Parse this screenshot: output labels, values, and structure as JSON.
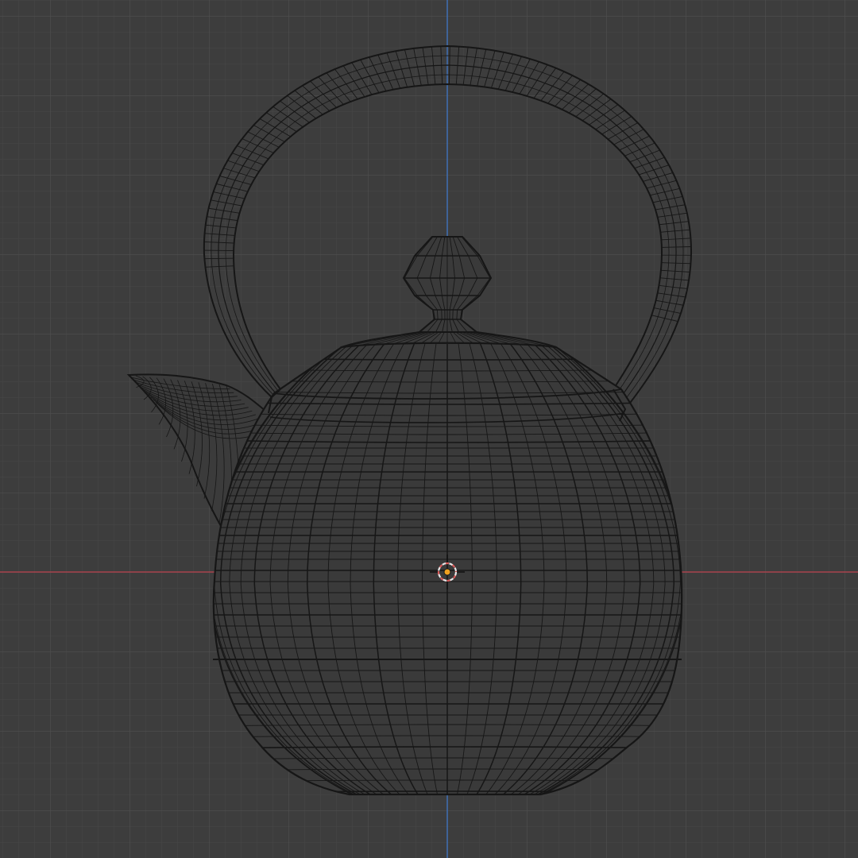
{
  "viewport": {
    "view": "front-orthographic",
    "shading": "wireframe",
    "object": "teapot-mesh"
  },
  "colors": {
    "background": "#3d3d3d",
    "grid_minor": "#474747",
    "grid_major": "#515151",
    "axis_x": "#a8434c",
    "axis_z": "#3f6fb4",
    "wire": "#161616",
    "cursor_outer": "#e8e8e8",
    "cursor_ring": "#d85a5a",
    "origin": "#f0a020"
  }
}
